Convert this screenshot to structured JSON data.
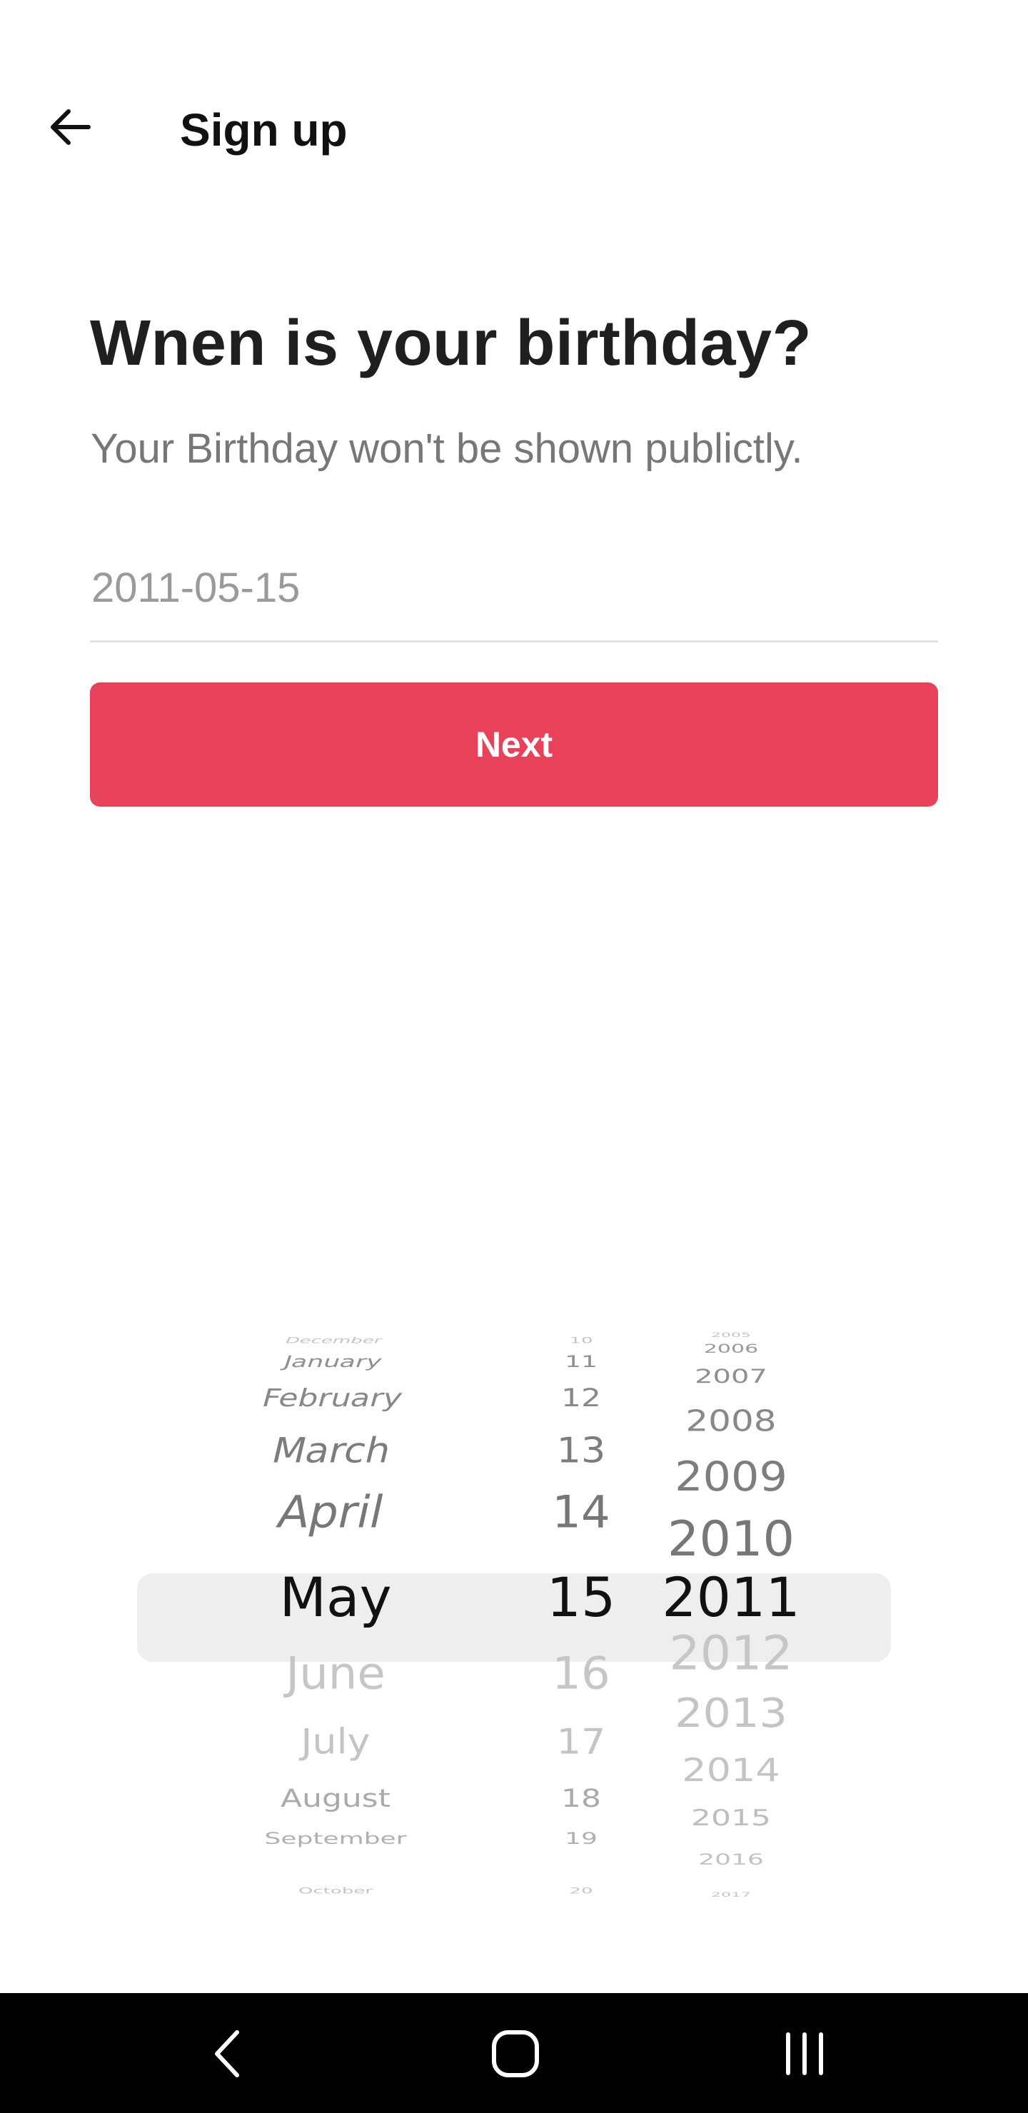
{
  "header": {
    "title": "Sign up",
    "back_icon": "arrow-left-icon"
  },
  "main": {
    "question": "Wnen is your birthday?",
    "subtitle": "Your Birthday won't be shown publictly.",
    "date_value": "2011-05-15",
    "next_label": "Next",
    "accent_color": "#e8425a"
  },
  "picker": {
    "months": [
      "December",
      "January",
      "February",
      "March",
      "April",
      "May",
      "June",
      "July",
      "August",
      "September",
      "October"
    ],
    "days": [
      "10",
      "11",
      "12",
      "13",
      "14",
      "15",
      "16",
      "17",
      "18",
      "19",
      "20"
    ],
    "years": [
      "2005",
      "2006",
      "2007",
      "2008",
      "2009",
      "2010",
      "2011",
      "2012",
      "2013",
      "2014",
      "2015",
      "2016",
      "2017"
    ],
    "selected_month": "May",
    "selected_day": "15",
    "selected_year": "2011"
  },
  "navbar": {
    "back_icon": "nav-back-icon",
    "home_icon": "home-icon",
    "recents_icon": "recents-icon"
  }
}
